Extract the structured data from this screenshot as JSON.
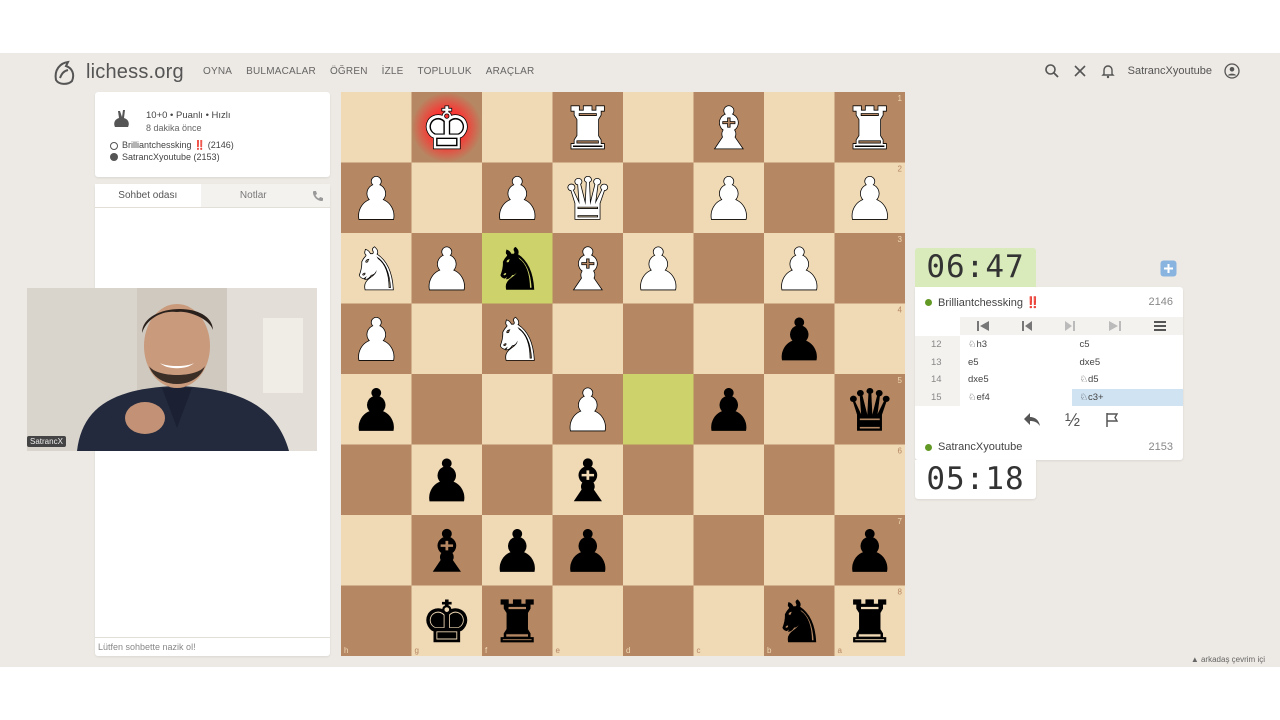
{
  "header": {
    "logo": "lichess.org",
    "nav": [
      "OYNA",
      "BULMACALAR",
      "ÖĞREN",
      "İZLE",
      "TOPLULUK",
      "ARAÇLAR"
    ],
    "username": "SatrancXyoutube"
  },
  "game_info": {
    "line1": "10+0 • Puanlı • Hızlı",
    "line2": "8 dakika önce",
    "players": [
      {
        "name": "Brilliantchessking ‼️ (2146)",
        "color": "white"
      },
      {
        "name": "SatrancXyoutube (2153)",
        "color": "black"
      }
    ]
  },
  "chat": {
    "tabs": [
      "Sohbet odası",
      "Notlar"
    ],
    "placeholder": "Lütfen sohbette nazik ol!"
  },
  "webcam": {
    "label": "SatrancX"
  },
  "board": {
    "orientation": "black",
    "files": [
      "h",
      "g",
      "f",
      "e",
      "d",
      "c",
      "b",
      "a"
    ],
    "ranks": [
      "1",
      "2",
      "3",
      "4",
      "5",
      "6",
      "7",
      "8"
    ],
    "colors": {
      "light": "#f0d9b5",
      "dark": "#b58863",
      "last_move": "#cdd26a",
      "last_move_dark": "#aaa23a",
      "check": "#ff3030"
    },
    "pieces": [
      {
        "sq": "a1",
        "p": "wR"
      },
      {
        "sq": "c1",
        "p": "wB"
      },
      {
        "sq": "e1",
        "p": "wR"
      },
      {
        "sq": "g1",
        "p": "wK"
      },
      {
        "sq": "a2",
        "p": "wP"
      },
      {
        "sq": "c2",
        "p": "wP"
      },
      {
        "sq": "e2",
        "p": "wQ"
      },
      {
        "sq": "f2",
        "p": "wP"
      },
      {
        "sq": "h2",
        "p": "wP"
      },
      {
        "sq": "b3",
        "p": "wP"
      },
      {
        "sq": "d3",
        "p": "wP"
      },
      {
        "sq": "e3",
        "p": "wB"
      },
      {
        "sq": "f3",
        "p": "bN"
      },
      {
        "sq": "g3",
        "p": "wP"
      },
      {
        "sq": "h3",
        "p": "wN"
      },
      {
        "sq": "f4",
        "p": "wN"
      },
      {
        "sq": "h4",
        "p": "wP"
      },
      {
        "sq": "b4",
        "p": "bP"
      },
      {
        "sq": "a5",
        "p": "bQ"
      },
      {
        "sq": "c5",
        "p": "bP"
      },
      {
        "sq": "e5",
        "p": "wP"
      },
      {
        "sq": "h5",
        "p": "bP"
      },
      {
        "sq": "e6",
        "p": "bB"
      },
      {
        "sq": "g6",
        "p": "bP"
      },
      {
        "sq": "a7",
        "p": "bP"
      },
      {
        "sq": "e7",
        "p": "bP"
      },
      {
        "sq": "f7",
        "p": "bP"
      },
      {
        "sq": "g7",
        "p": "bB"
      },
      {
        "sq": "a8",
        "p": "bR"
      },
      {
        "sq": "b8",
        "p": "bN"
      },
      {
        "sq": "f8",
        "p": "bR"
      },
      {
        "sq": "g8",
        "p": "bK"
      }
    ],
    "last_move": [
      "d5",
      "f3"
    ],
    "check": "g1"
  },
  "clocks": {
    "top": "06:47",
    "bottom": "05:18"
  },
  "players_panel": {
    "top": {
      "name": "Brilliantchessking ‼️",
      "rating": "2146"
    },
    "bottom": {
      "name": "SatrancXyoutube",
      "rating": "2153"
    }
  },
  "moves": [
    {
      "n": "12",
      "w": "♘h3",
      "b": "c5"
    },
    {
      "n": "13",
      "w": "e5",
      "b": "dxe5"
    },
    {
      "n": "14",
      "w": "dxe5",
      "b": "♘d5"
    },
    {
      "n": "15",
      "w": "♘ef4",
      "b": "♘c3+"
    }
  ],
  "active_move": {
    "row": 3,
    "side": "b"
  },
  "actions": {
    "draw": "½"
  },
  "footer": {
    "friends": "arkadaş çevrim içi"
  }
}
